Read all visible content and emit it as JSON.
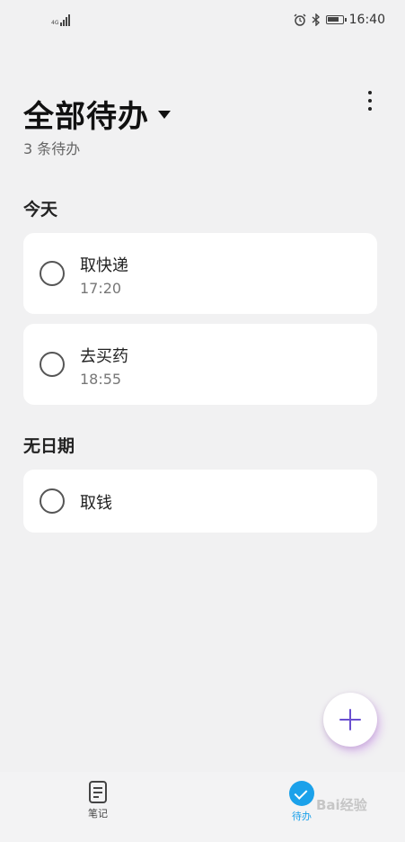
{
  "status_bar": {
    "network": "4G",
    "time": "16:40",
    "icons": [
      "alarm-icon",
      "bluetooth-icon",
      "battery-icon"
    ]
  },
  "header": {
    "title": "全部待办",
    "subtitle": "3 条待办"
  },
  "sections": [
    {
      "label": "今天",
      "tasks": [
        {
          "title": "取快递",
          "time": "17:20"
        },
        {
          "title": "去买药",
          "time": "18:55"
        }
      ]
    },
    {
      "label": "无日期",
      "tasks": [
        {
          "title": "取钱"
        }
      ]
    }
  ],
  "bottom_nav": {
    "items": [
      {
        "label": "笔记",
        "icon": "notes-icon",
        "active": false
      },
      {
        "label": "待办",
        "icon": "todo-check-icon",
        "active": true
      }
    ],
    "active_color": "#1ba1ea",
    "inactive_color": "#444444"
  },
  "fab": {
    "icon": "plus-icon",
    "color": "#6a4fd0"
  },
  "watermark": "Bai经验"
}
